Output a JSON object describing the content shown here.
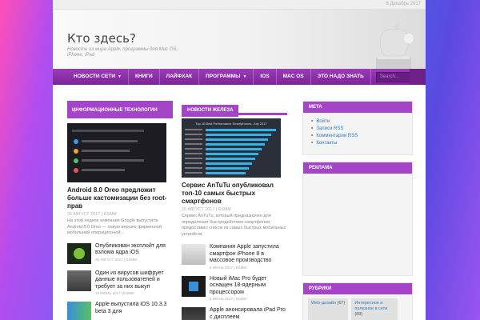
{
  "topbar": {
    "date": "6 Декабрь 2017"
  },
  "header": {
    "title": "Кто здесь?",
    "description": "Новости из мира Apple, программы для Mac OS, iPhone, iPad"
  },
  "nav": {
    "items": [
      {
        "label": "НОВОСТИ СЕТИ",
        "dropdown": true
      },
      {
        "label": "КНИГИ",
        "dropdown": false
      },
      {
        "label": "ЛАЙФХАК",
        "dropdown": false
      },
      {
        "label": "ПРОГРАММЫ",
        "dropdown": true
      },
      {
        "label": "IOS",
        "dropdown": false
      },
      {
        "label": "MAC OS",
        "dropdown": false
      },
      {
        "label": "ЭТО НАДО ЗНАТЬ",
        "dropdown": false
      }
    ],
    "search_placeholder": "Search..."
  },
  "col1": {
    "section": "ИНФОРМАЦИОННЫЕ ТЕХНОЛОГИИ",
    "featured": {
      "title": "Android 8.0 Oreo предложит больше кастомизации без root-прав",
      "meta": "26 АВГУСТ 2017 | ESMM",
      "excerpt": "На этой неделе компания Google выпустила Android 8.0 Oreo — новую версию фирменной мобильной операционной..."
    },
    "items": [
      {
        "title": "Опубликован эксплойт для взлома ядра iOS",
        "meta": "26 АВГУСТ 2017 | ESMM"
      },
      {
        "title": "Один из вирусов шифрует данные пользователей и требует за них выкуп",
        "meta": "16 ИЮНЬ 2017 | ESMM"
      },
      {
        "title": "Apple выпустила iOS 10.3.3 beta 3 для",
        "meta": ""
      }
    ]
  },
  "col2": {
    "section": "НОВОСТИ ЖЕЛЕЗА",
    "featured": {
      "chart_caption": "Top 10 Best Performance Smartphones, July 2017",
      "title": "Сервис AnTuTu опубликовал топ-10 самых быстрых смартфонов",
      "meta": "26 АВГУСТ 2017 | ESMM",
      "excerpt": "Сервис AnTuTu, который предназначен для определения быстродействия смартфонов, предоставил список из самых быстрых мобильных устройств."
    },
    "items": [
      {
        "title": "Компания Apple запустила смартфон iPhone 8 в массовое производство",
        "meta": "8 ИЮНЬ 2017 | ESMM"
      },
      {
        "title": "Новый iMac Pro будет оснащен 18-ядерным процессором",
        "meta": "8 ИЮНЬ 2017 | ESMM"
      },
      {
        "title": "Apple анонсировала iPad Pro с дисплеем",
        "meta": ""
      }
    ]
  },
  "sidebar": {
    "meta_title": "МЕТА",
    "meta_links": [
      "Войти",
      "Записи RSS",
      "Комментарии RSS",
      "Контакты"
    ],
    "ads_title": "РЕКЛАМА",
    "rubrics_title": "РУБРИКИ",
    "rubrics": [
      {
        "label": "Web-дизайн",
        "count": "(67)"
      },
      {
        "label": "Интересное и полезное в сети",
        "count": "(89)"
      }
    ]
  },
  "colors": {
    "accent": "#a445c9",
    "nav": "#8a2ea8",
    "link": "#2a7cbf"
  }
}
